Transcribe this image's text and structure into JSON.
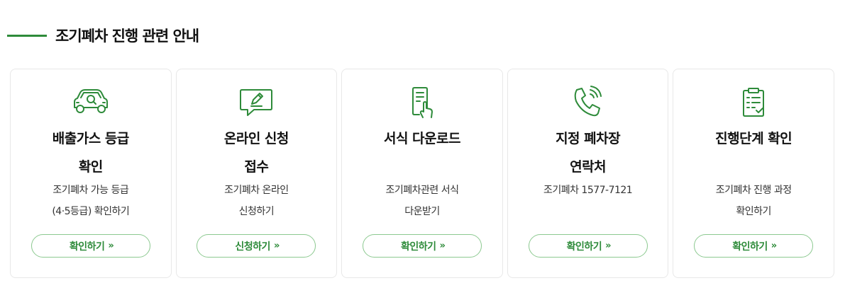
{
  "section": {
    "title": "조기폐차 진행 관련 안내",
    "accent_color": "#2e8b3a"
  },
  "cards": [
    {
      "icon": "car-search-icon",
      "title_line1": "배출가스 등급",
      "title_line2": "확인",
      "desc_line1": "조기폐차 가능 등급",
      "desc_line2": "(4·5등급) 확인하기",
      "button_label": "확인하기",
      "button_arrow": "»"
    },
    {
      "icon": "chat-pen-icon",
      "title_line1": "온라인 신청",
      "title_line2": "접수",
      "desc_line1": "조기폐차 온라인",
      "desc_line2": "신청하기",
      "button_label": "신청하기",
      "button_arrow": "»"
    },
    {
      "icon": "document-download-icon",
      "title_line1": "서식 다운로드",
      "title_line2": "",
      "desc_line1": "조기폐차관련 서식",
      "desc_line2": "다운받기",
      "button_label": "확인하기",
      "button_arrow": "»"
    },
    {
      "icon": "phone-icon",
      "title_line1": "지정 폐차장",
      "title_line2": "연락처",
      "desc_line1": "조기폐차 1577-7121",
      "desc_line2": "",
      "button_label": "확인하기",
      "button_arrow": "»"
    },
    {
      "icon": "clipboard-check-icon",
      "title_line1": "진행단계 확인",
      "title_line2": "",
      "desc_line1": "조기폐차 진행 과정",
      "desc_line2": "확인하기",
      "button_label": "확인하기",
      "button_arrow": "»"
    }
  ]
}
